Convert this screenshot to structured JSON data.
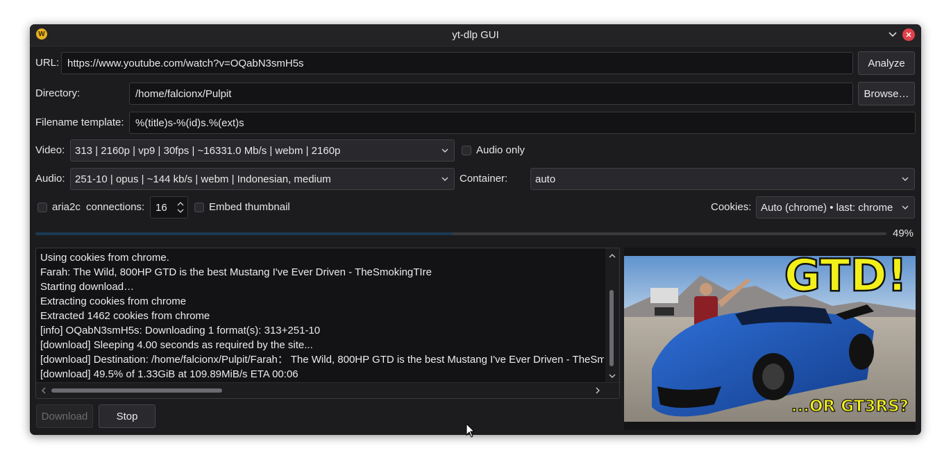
{
  "window": {
    "title": "yt-dlp GUI",
    "app_icon_letter": "W"
  },
  "url": {
    "label": "URL:",
    "value": "https://www.youtube.com/watch?v=OQabN3smH5s",
    "analyze_button": "Analyze"
  },
  "directory": {
    "label": "Directory:",
    "value": "/home/falcionx/Pulpit",
    "browse_button": "Browse…"
  },
  "filename": {
    "label": "Filename template:",
    "value": "%(title)s-%(id)s.%(ext)s"
  },
  "video": {
    "label": "Video:",
    "selected": "313 | 2160p | vp9 | 30fps | ~16331.0 Mb/s | webm | 2160p",
    "audio_only_label": "Audio only",
    "audio_only_checked": false
  },
  "audio": {
    "label": "Audio:",
    "selected": "251-10 | opus | ~144 kb/s | webm | Indonesian, medium",
    "container_label": "Container:",
    "container_selected": "auto"
  },
  "options": {
    "aria2c_label": "aria2c",
    "aria2c_checked": false,
    "connections_label": "connections:",
    "connections_value": "16",
    "embed_thumbnail_label": "Embed thumbnail",
    "embed_thumbnail_checked": false,
    "cookies_label": "Cookies:",
    "cookies_selected": "Auto (chrome) • last: chrome"
  },
  "progress": {
    "percent": 49,
    "text": "49%"
  },
  "log": {
    "lines": [
      "Using cookies from chrome.",
      "Farah: The Wild, 800HP GTD is the best Mustang I've Ever Driven - TheSmokingTIre",
      "Starting download…",
      "Extracting cookies from chrome",
      "Extracted 1462 cookies from chrome",
      "[info] OQabN3smH5s: Downloading 1 format(s): 313+251-10",
      "[download] Sleeping 4.00 seconds as required by the site...",
      "[download] Destination: /home/falcionx/Pulpit/Farah： The Wild, 800HP GTD is the best Mustang I've Ever Driven - TheSmokingTIre",
      "[download] 49.5% of 1.33GiB at 109.89MiB/s ETA 00:06"
    ]
  },
  "actions": {
    "download_button": "Download",
    "stop_button": "Stop"
  },
  "thumbnail": {
    "headline": "GTD!",
    "tagline": "...OR GT3RS?"
  },
  "colors": {
    "window_bg": "#1c1c1e",
    "field_bg": "#131315",
    "progress_fill": "#1b3a52",
    "close_button": "#e0404a",
    "thumbnail_text": "#f2f01a"
  }
}
